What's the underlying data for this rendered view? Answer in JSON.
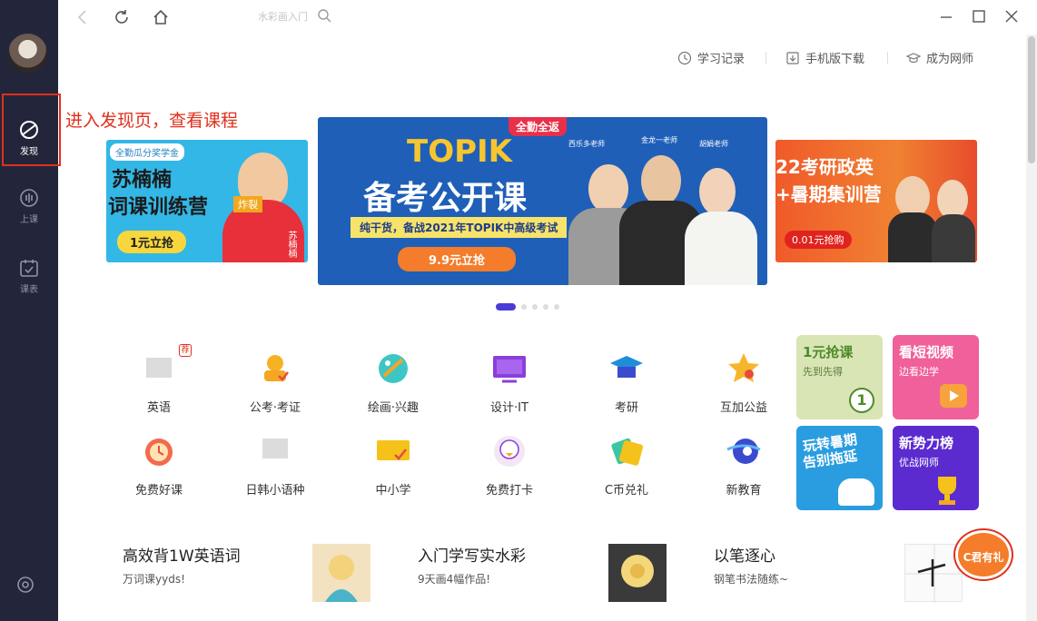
{
  "sidebar": {
    "items": [
      {
        "label": "发现",
        "icon": "discover-icon"
      },
      {
        "label": "上课",
        "icon": "live-class-icon"
      },
      {
        "label": "课表",
        "icon": "schedule-icon"
      }
    ]
  },
  "topbar": {
    "search_placeholder": "水彩画入门"
  },
  "toplinks": {
    "history": "学习记录",
    "mobile": "手机版下载",
    "teacher": "成为网师"
  },
  "annotation": "进入发现页，查看课程",
  "banners": {
    "left": {
      "tag": "全勤瓜分奖学金",
      "title1": "苏楠楠",
      "title2": "词课训练营",
      "badge": "炸裂",
      "name": "苏楠楠",
      "cta": "1元立抢"
    },
    "mid": {
      "tag": "全勤全返",
      "teachers": [
        "西乐多老师",
        "金龙一老师",
        "胡娟老师"
      ],
      "brand": "TOPIK",
      "title": "备考公开课",
      "sub": "纯干货，备战2021年TOPIK中高级考试",
      "cta": "9.9元立抢"
    },
    "right": {
      "title1": "22考研政英",
      "title2": "+暑期集训营",
      "cta": "0.01元抢购"
    }
  },
  "categories": [
    {
      "label": "英语",
      "icon": "english-icon"
    },
    {
      "label": "公考·考证",
      "icon": "exam-cert-icon"
    },
    {
      "label": "绘画·兴趣",
      "icon": "painting-icon"
    },
    {
      "label": "设计·IT",
      "icon": "design-it-icon"
    },
    {
      "label": "考研",
      "icon": "graduate-exam-icon"
    },
    {
      "label": "互加公益",
      "icon": "charity-icon"
    },
    {
      "label": "免费好课",
      "icon": "free-course-icon"
    },
    {
      "label": "日韩小语种",
      "icon": "language-icon"
    },
    {
      "label": "中小学",
      "icon": "k12-icon"
    },
    {
      "label": "免费打卡",
      "icon": "checkin-icon"
    },
    {
      "label": "C币兑礼",
      "icon": "coin-gift-icon"
    },
    {
      "label": "新教育",
      "icon": "new-education-icon"
    }
  ],
  "english_badge": "荐",
  "promos": [
    {
      "title": "1元抢课",
      "sub": "先到先得",
      "num": "1",
      "bg": "#d9e5b4",
      "color": "#4f8a2a"
    },
    {
      "title": "看短视频",
      "sub": "边看边学",
      "bg": "#f0609a",
      "color": "#ffffff"
    },
    {
      "title": "玩转暑期",
      "title2": "告别拖延",
      "bg": "#2a9de0",
      "color": "#ffffff"
    },
    {
      "title": "新势力榜",
      "sub": "优战网师",
      "bg": "#5b2bd0",
      "color": "#ffffff"
    }
  ],
  "courses": [
    {
      "title": "高效背1W英语词",
      "sub": "万词课yyds!"
    },
    {
      "title": "入门学写实水彩",
      "sub": "9天画4幅作品!"
    },
    {
      "title": "以笔逐心",
      "sub": "钢笔书法随练~"
    }
  ],
  "floating_badge": "C君有礼",
  "colors": {
    "sidebar": "#23263a",
    "accent": "#4b3bd6",
    "annotation": "#e0301e"
  }
}
